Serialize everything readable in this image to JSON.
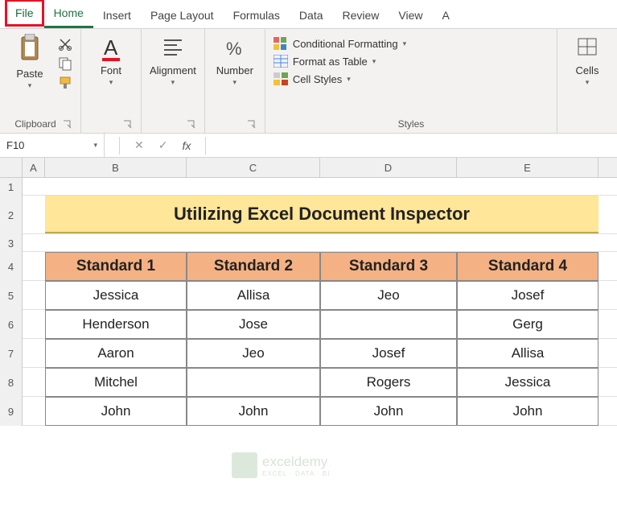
{
  "tabs": [
    "File",
    "Home",
    "Insert",
    "Page Layout",
    "Formulas",
    "Data",
    "Review",
    "View",
    "A"
  ],
  "active_tab": "Home",
  "highlighted_tab": "File",
  "ribbon": {
    "clipboard": {
      "paste": "Paste",
      "label": "Clipboard"
    },
    "font": {
      "btn": "Font"
    },
    "alignment": {
      "btn": "Alignment"
    },
    "number": {
      "btn": "Number"
    },
    "styles": {
      "cond": "Conditional Formatting",
      "table": "Format as Table",
      "cell": "Cell Styles",
      "label": "Styles"
    },
    "cells": {
      "btn": "Cells"
    }
  },
  "name_box": "F10",
  "formula_bar": {
    "fx": "fx",
    "value": ""
  },
  "columns": [
    "A",
    "B",
    "C",
    "D",
    "E"
  ],
  "rows": [
    "1",
    "2",
    "3",
    "4",
    "5",
    "6",
    "7",
    "8",
    "9"
  ],
  "title": "Utilizing Excel Document Inspector",
  "chart_data": {
    "type": "table",
    "title": "Utilizing Excel Document Inspector",
    "columns": [
      "Standard 1",
      "Standard 2",
      "Standard 3",
      "Standard 4"
    ],
    "rows": [
      [
        "Jessica",
        "Allisa",
        "Jeo",
        "Josef"
      ],
      [
        "Henderson",
        "Jose",
        "",
        "Gerg"
      ],
      [
        "Aaron",
        "Jeo",
        "Josef",
        "Allisa"
      ],
      [
        "Mitchel",
        "",
        "Rogers",
        "Jessica"
      ],
      [
        "John",
        "John",
        "John",
        "John"
      ]
    ]
  },
  "watermark": {
    "text": "exceldemy",
    "sub": "EXCEL · DATA · BI"
  }
}
